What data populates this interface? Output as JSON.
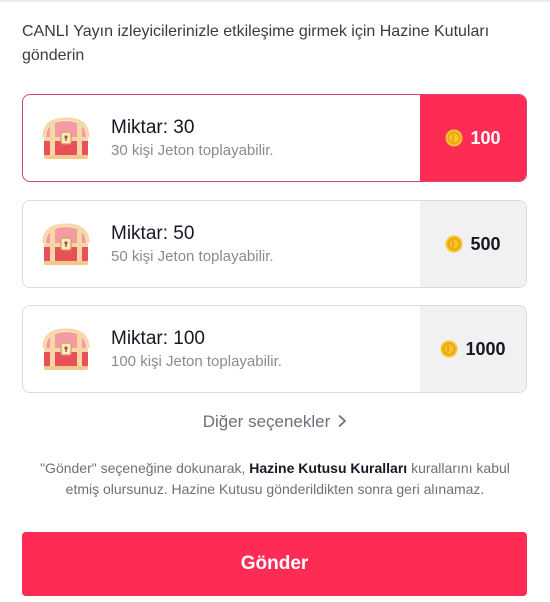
{
  "intro_text": "CANLI Yayın izleyicilerinizle etkileşime girmek için Hazine Kutuları gönderin",
  "options": [
    {
      "title": "Miktar: 30",
      "subtitle": "30 kişi Jeton toplayabilir.",
      "price": "100",
      "selected": true,
      "icon": "treasure-chest-icon"
    },
    {
      "title": "Miktar: 50",
      "subtitle": "50 kişi Jeton toplayabilir.",
      "price": "500",
      "selected": false,
      "icon": "treasure-chest-icon"
    },
    {
      "title": "Miktar: 100",
      "subtitle": "100 kişi Jeton toplayabilir.",
      "price": "1000",
      "selected": false,
      "icon": "treasure-chest-icon"
    }
  ],
  "more_options": {
    "label": "Diğer seçenekler",
    "icon": "chevron-right-icon"
  },
  "terms": {
    "prefix": "\"Gönder\" seçeneğine dokunarak, ",
    "link": "Hazine Kutusu Kuralları",
    "suffix": " kurallarını kabul etmiş olursunuz. Hazine Kutusu gönderildikten sonra geri alınamaz."
  },
  "send_button": {
    "label": "Gönder"
  },
  "colors": {
    "accent": "#fe2c55",
    "coin": "#f9c22e",
    "price_bg": "#f1f1f2",
    "text": "#161823",
    "muted": "#8a8b91"
  }
}
